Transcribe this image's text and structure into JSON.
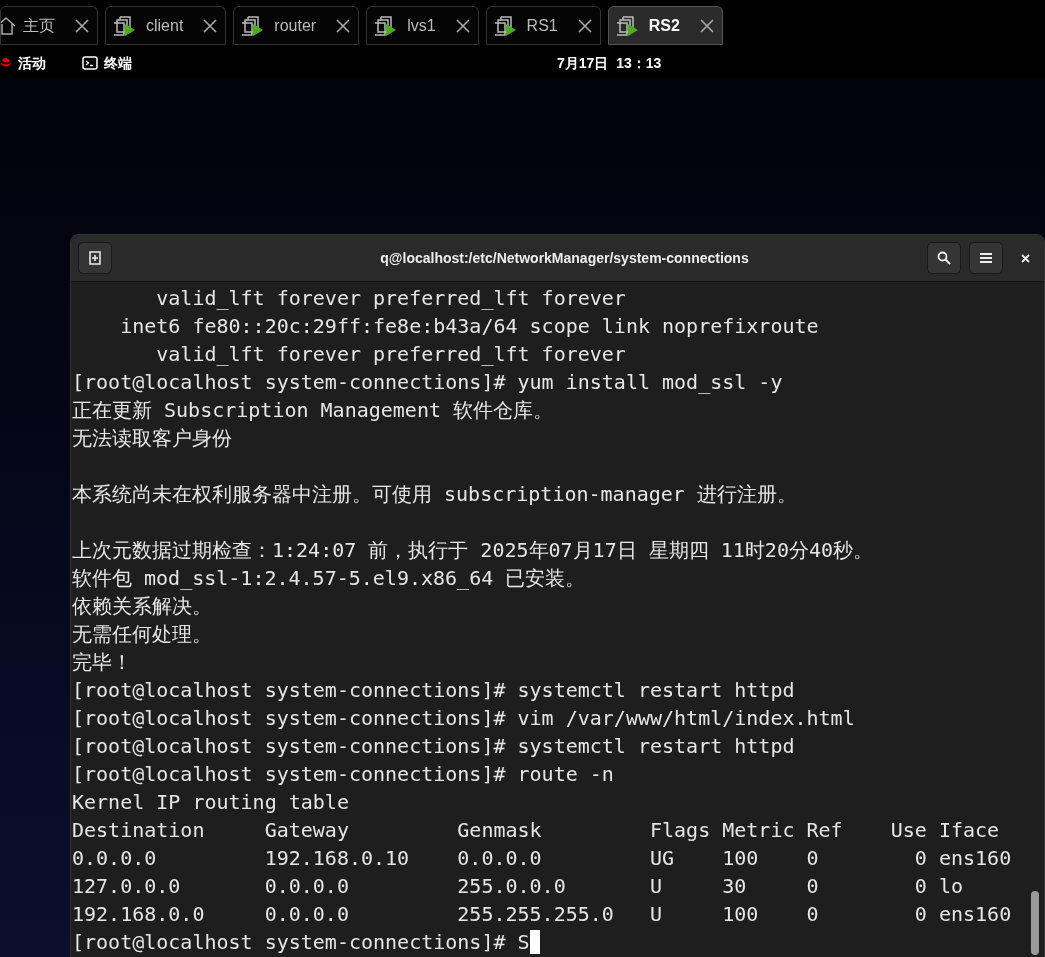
{
  "tabs": [
    {
      "kind": "home",
      "label": "主页",
      "selected": false
    },
    {
      "kind": "vm",
      "label": "client",
      "selected": false
    },
    {
      "kind": "vm",
      "label": "router",
      "selected": false
    },
    {
      "kind": "vm",
      "label": "lvs1",
      "selected": false
    },
    {
      "kind": "vm",
      "label": "RS1",
      "selected": false
    },
    {
      "kind": "vm",
      "label": "RS2",
      "selected": true
    }
  ],
  "top_bar": {
    "activities": "活动",
    "app": "终端",
    "clock": "7月17日  13：13"
  },
  "terminal": {
    "title": "q@localhost:/etc/NetworkManager/system-connections",
    "blocks": [
      [
        "       valid_lft forever preferred_lft forever",
        "    inet6 fe80::20c:29ff:fe8e:b43a/64 scope link noprefixroute",
        "       valid_lft forever preferred_lft forever",
        "[root@localhost system-connections]# yum install mod_ssl -y",
        "正在更新 Subscription Management 软件仓库。",
        "无法读取客户身份"
      ],
      [
        "本系统尚未在权利服务器中注册。可使用 subscription-manager 进行注册。"
      ],
      [
        "上次元数据过期检查：1:24:07 前，执行于 2025年07月17日 星期四 11时20分40秒。",
        "软件包 mod_ssl-1:2.4.57-5.el9.x86_64 已安装。",
        "依赖关系解决。",
        "无需任何处理。",
        "完毕！",
        "[root@localhost system-connections]# systemctl restart httpd",
        "[root@localhost system-connections]# vim /var/www/html/index.html",
        "[root@localhost system-connections]# systemctl restart httpd",
        "[root@localhost system-connections]# route -n",
        "Kernel IP routing table",
        "Destination     Gateway         Genmask         Flags Metric Ref    Use Iface",
        "0.0.0.0         192.168.0.10    0.0.0.0         UG    100    0        0 ens160",
        "127.0.0.0       0.0.0.0         255.0.0.0       U     30     0        0 lo",
        "192.168.0.0     0.0.0.0         255.255.255.0   U     100    0        0 ens160",
        "[root@localhost system-connections]# S"
      ]
    ]
  }
}
